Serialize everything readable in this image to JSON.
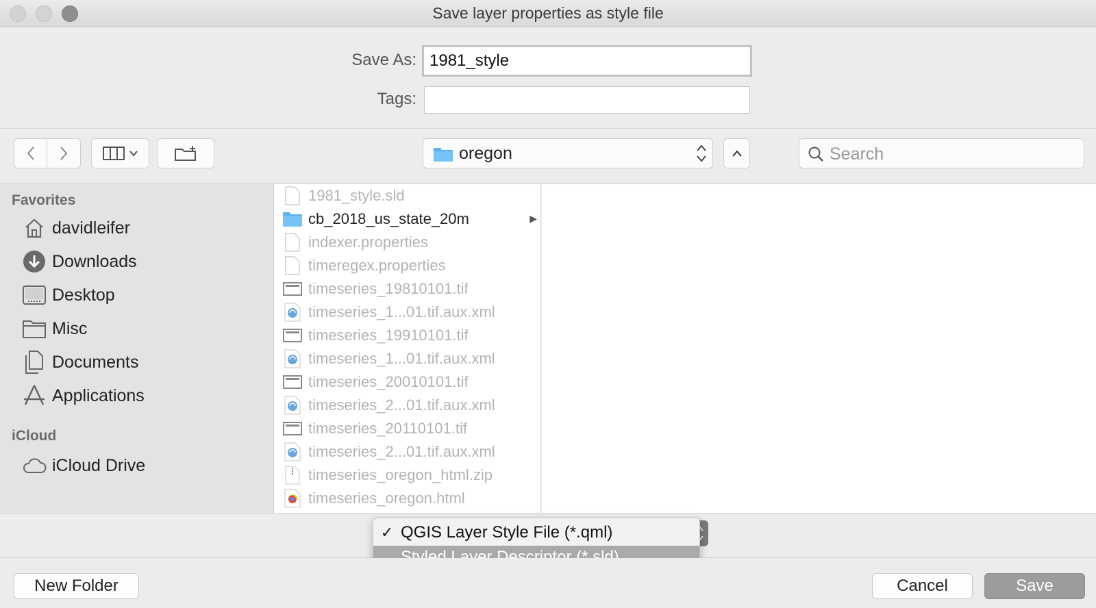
{
  "window": {
    "title": "Save layer properties as style file"
  },
  "form": {
    "save_as_label": "Save As:",
    "save_as_value": "1981_style",
    "tags_label": "Tags:",
    "tags_value": ""
  },
  "toolbar": {
    "location": "oregon",
    "search_placeholder": "Search"
  },
  "sidebar": {
    "favorites_heading": "Favorites",
    "favorites": [
      {
        "label": "davidleifer",
        "icon": "home-icon"
      },
      {
        "label": "Downloads",
        "icon": "downloads-icon"
      },
      {
        "label": "Desktop",
        "icon": "desktop-icon"
      },
      {
        "label": "Misc",
        "icon": "folder-icon"
      },
      {
        "label": "Documents",
        "icon": "documents-icon"
      },
      {
        "label": "Applications",
        "icon": "applications-icon"
      }
    ],
    "icloud_heading": "iCloud",
    "icloud": [
      {
        "label": "iCloud Drive",
        "icon": "cloud-icon"
      }
    ]
  },
  "files": [
    {
      "name": "1981_style.sld",
      "icon": "document-icon",
      "type": "file"
    },
    {
      "name": "cb_2018_us_state_20m",
      "icon": "folder-icon",
      "type": "folder"
    },
    {
      "name": "indexer.properties",
      "icon": "document-icon",
      "type": "file"
    },
    {
      "name": "timeregex.properties",
      "icon": "document-icon",
      "type": "file"
    },
    {
      "name": "timeseries_19810101.tif",
      "icon": "image-icon",
      "type": "file"
    },
    {
      "name": "timeseries_1...01.tif.aux.xml",
      "icon": "xml-icon",
      "type": "file"
    },
    {
      "name": "timeseries_19910101.tif",
      "icon": "image-icon",
      "type": "file"
    },
    {
      "name": "timeseries_1...01.tif.aux.xml",
      "icon": "xml-icon",
      "type": "file"
    },
    {
      "name": "timeseries_20010101.tif",
      "icon": "image-icon",
      "type": "file"
    },
    {
      "name": "timeseries_2...01.tif.aux.xml",
      "icon": "xml-icon",
      "type": "file"
    },
    {
      "name": "timeseries_20110101.tif",
      "icon": "image-icon",
      "type": "file"
    },
    {
      "name": "timeseries_2...01.tif.aux.xml",
      "icon": "xml-icon",
      "type": "file"
    },
    {
      "name": "timeseries_oregon_html.zip",
      "icon": "zip-icon",
      "type": "file"
    },
    {
      "name": "timeseries_oregon.html",
      "icon": "html-icon",
      "type": "file"
    }
  ],
  "format_menu": {
    "options": [
      {
        "label": "QGIS Layer Style File (*.qml)",
        "checked": "✓"
      },
      {
        "label": "Styled Layer Descriptor (*.sld)",
        "checked": ""
      }
    ]
  },
  "buttons": {
    "new_folder": "New Folder",
    "cancel": "Cancel",
    "save": "Save"
  },
  "colors": {
    "folder": "#5ab4f0",
    "selected_menu": "#a9a9a9"
  }
}
